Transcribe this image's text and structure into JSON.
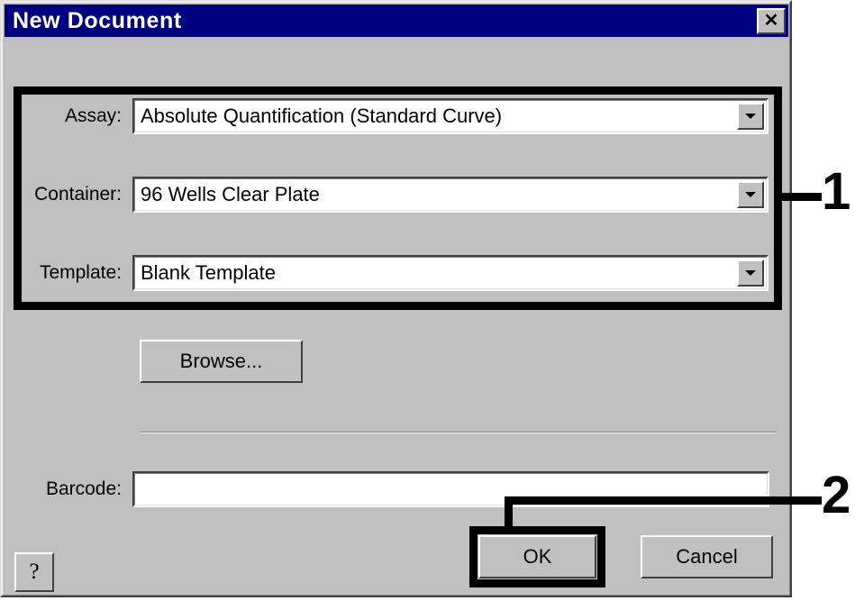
{
  "window": {
    "title": "New Document",
    "close_icon": "close-icon",
    "close_glyph": "✕",
    "titlebar_color": "#000080",
    "face_color": "#c0c0c0"
  },
  "form": {
    "rows": [
      {
        "label": "Assay:",
        "value": "Absolute Quantification (Standard Curve)",
        "arrow_icon": "chevron-down-icon"
      },
      {
        "label": "Container:",
        "value": "96 Wells Clear Plate",
        "arrow_icon": "chevron-down-icon"
      },
      {
        "label": "Template:",
        "value": "Blank Template",
        "arrow_icon": "chevron-down-icon"
      }
    ],
    "browse_label": "Browse...",
    "barcode": {
      "label": "Barcode:",
      "value": "",
      "placeholder": ""
    }
  },
  "buttons": {
    "help_label": "?",
    "ok_label": "OK",
    "cancel_label": "Cancel"
  },
  "annotations": [
    {
      "number": "1",
      "target": "assay-container-template-group"
    },
    {
      "number": "2",
      "target": "ok-button"
    }
  ]
}
